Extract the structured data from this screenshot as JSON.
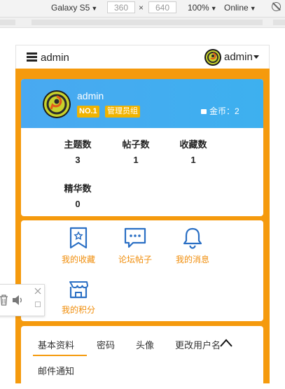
{
  "devtools": {
    "device": "Galaxy S5",
    "width": "360",
    "height": "640",
    "times": "×",
    "zoom": "100%",
    "network": "Online"
  },
  "navbar": {
    "brand": "admin",
    "user": "admin"
  },
  "profile": {
    "name": "admin",
    "rank_badge": "NO.1",
    "group_badge": "管理员组",
    "coins": "金币：2"
  },
  "stats": [
    {
      "label": "主题数",
      "value": "3"
    },
    {
      "label": "帖子数",
      "value": "1"
    },
    {
      "label": "收藏数",
      "value": "1"
    },
    {
      "label": "精华数",
      "value": "0"
    }
  ],
  "quick_links": [
    {
      "label": "我的收藏",
      "icon": "bookmark-icon"
    },
    {
      "label": "论坛帖子",
      "icon": "chat-icon"
    },
    {
      "label": "我的消息",
      "icon": "bell-icon"
    },
    {
      "label": "我的积分",
      "icon": "shop-icon"
    }
  ],
  "tabs": [
    "基本资料",
    "密码",
    "头像",
    "更改用户名",
    "邮件通知"
  ],
  "colors": {
    "accent": "#f59a0d",
    "header_blue": "#49a9f1",
    "badge_yellow": "#f0b300",
    "link_orange": "#f08d0a"
  }
}
